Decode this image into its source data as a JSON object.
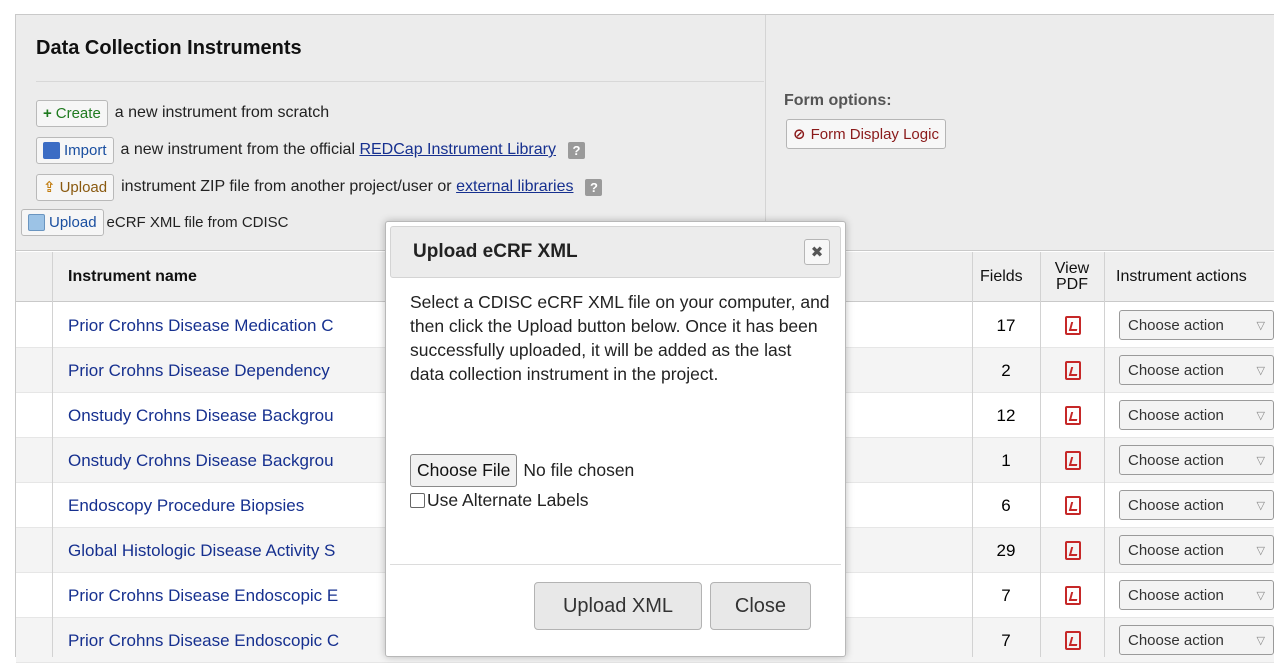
{
  "header": {
    "title": "Data Collection Instruments",
    "actions": [
      {
        "button": "Create",
        "icon": "plus-icon",
        "text": "a new instrument from scratch"
      },
      {
        "button": "Import",
        "icon": "import-icon",
        "text_before": "a new instrument from the official",
        "link": "REDCap Instrument Library"
      },
      {
        "button": "Upload",
        "icon": "upload-icon",
        "text_before": "instrument ZIP file from another project/user or",
        "link": "external libraries"
      },
      {
        "button": "Upload",
        "icon": "xml-upload-icon",
        "text": "eCRF XML file from CDISC"
      }
    ],
    "help_glyph": "?",
    "form_options_label": "Form options:",
    "form_display_logic_button": "Form Display Logic"
  },
  "table": {
    "columns": {
      "name": "Instrument name",
      "fields": "Fields",
      "view_pdf_1": "View",
      "view_pdf_2": "PDF",
      "actions": "Instrument actions"
    },
    "rows": [
      {
        "name": "Prior Crohns Disease Medication C",
        "fields": "17"
      },
      {
        "name": "Prior Crohns Disease Dependency",
        "fields": "2"
      },
      {
        "name": "Onstudy Crohns Disease Backgrou",
        "fields": "12"
      },
      {
        "name": "Onstudy Crohns Disease Backgrou",
        "fields": "1"
      },
      {
        "name": "Endoscopy Procedure Biopsies",
        "fields": "6"
      },
      {
        "name": "Global Histologic Disease Activity S",
        "fields": "29"
      },
      {
        "name": "Prior Crohns Disease Endoscopic E",
        "fields": "7"
      },
      {
        "name": "Prior Crohns Disease Endoscopic C",
        "fields": "7"
      }
    ],
    "action_label": "Choose action"
  },
  "modal": {
    "title": "Upload eCRF XML",
    "close_glyph": "✖",
    "body": "Select a CDISC eCRF XML file on your computer, and then click the Upload button below. Once it has been successfully uploaded, it will be added as the last data collection instrument in the project.",
    "choose_file": "Choose File",
    "no_file": "No file chosen",
    "alt_labels": "Use Alternate Labels",
    "upload_button": "Upload XML",
    "close_button": "Close"
  },
  "colors": {
    "link": "#16308f",
    "create": "#1f7a1f",
    "pdf": "#c62828",
    "header_bg": "#ececec"
  }
}
